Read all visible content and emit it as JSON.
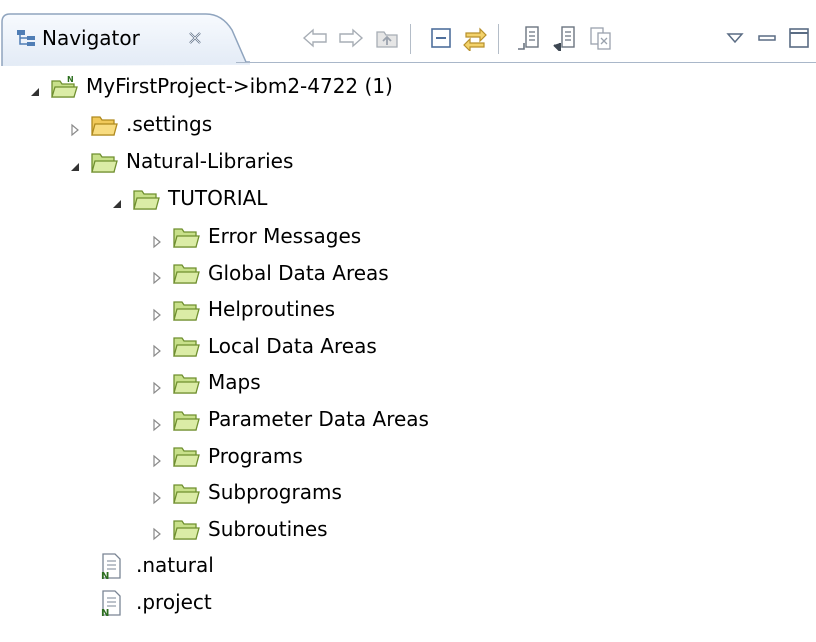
{
  "view": {
    "tab_title": "Navigator",
    "toolbar": [
      {
        "name": "back-icon"
      },
      {
        "name": "forward-icon"
      },
      {
        "name": "up-icon"
      },
      {
        "name": "collapse-all-icon"
      },
      {
        "name": "link-with-editor-icon"
      },
      {
        "name": "upload-icon"
      },
      {
        "name": "download-icon"
      },
      {
        "name": "compare-icon"
      },
      {
        "name": "view-menu-icon"
      },
      {
        "name": "minimize-icon"
      },
      {
        "name": "maximize-icon"
      }
    ]
  },
  "tree": {
    "project": {
      "label": "MyFirstProject->ibm2-4722 (1)",
      "expanded": true
    },
    "settings": {
      "label": ".settings",
      "expanded": false
    },
    "natural_libraries": {
      "label": "Natural-Libraries",
      "expanded": true
    },
    "tutorial": {
      "label": "TUTORIAL",
      "expanded": true
    },
    "tutorial_children": [
      "Error Messages",
      "Global Data Areas",
      "Helproutines",
      "Local Data Areas",
      "Maps",
      "Parameter Data Areas",
      "Programs",
      "Subprograms",
      "Subroutines"
    ],
    "files": [
      ".natural",
      ".project"
    ]
  },
  "colors": {
    "folder_fill": "#c8e08a",
    "folder_stroke": "#6f8f2f",
    "tab_border": "#8fa4be",
    "tab_bg": "#eef3fa"
  }
}
